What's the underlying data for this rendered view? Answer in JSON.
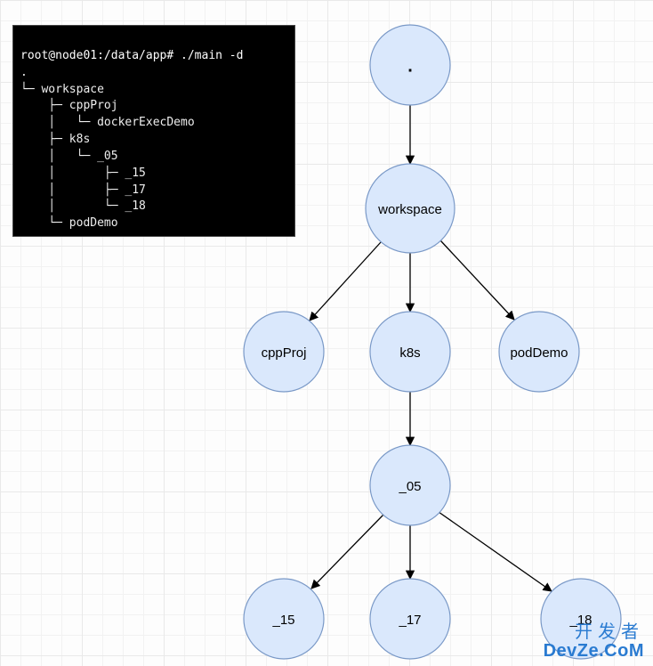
{
  "terminal": {
    "prompt": "root@node01:/data/app# ./main -d",
    "lines": [
      ".",
      "└─ workspace",
      "    ├─ cppProj",
      "    │   └─ dockerExecDemo",
      "    ├─ k8s",
      "    │   └─ _05",
      "    │       ├─ _15",
      "    │       ├─ _17",
      "    │       └─ _18",
      "    └─ podDemo"
    ]
  },
  "nodes": {
    "root": {
      "label": "."
    },
    "workspace": {
      "label": "workspace"
    },
    "cppProj": {
      "label": "cppProj"
    },
    "k8s": {
      "label": "k8s"
    },
    "podDemo": {
      "label": "podDemo"
    },
    "n05": {
      "label": "_05"
    },
    "n15": {
      "label": "_15"
    },
    "n17": {
      "label": "_17"
    },
    "n18": {
      "label": "_18"
    }
  },
  "tree": {
    "root": ".",
    "children": [
      {
        "name": "workspace",
        "children": [
          {
            "name": "cppProj",
            "children": [
              {
                "name": "dockerExecDemo"
              }
            ]
          },
          {
            "name": "k8s",
            "children": [
              {
                "name": "_05",
                "children": [
                  {
                    "name": "_15"
                  },
                  {
                    "name": "_17"
                  },
                  {
                    "name": "_18"
                  }
                ]
              }
            ]
          },
          {
            "name": "podDemo"
          }
        ]
      }
    ]
  },
  "watermark": {
    "line1": "开发者",
    "line2": "DevZe.CoM"
  },
  "colors": {
    "node_fill": "#dae8fc",
    "node_stroke": "#7a99c7",
    "edge": "#000000",
    "grid": "#e9e9e9"
  }
}
